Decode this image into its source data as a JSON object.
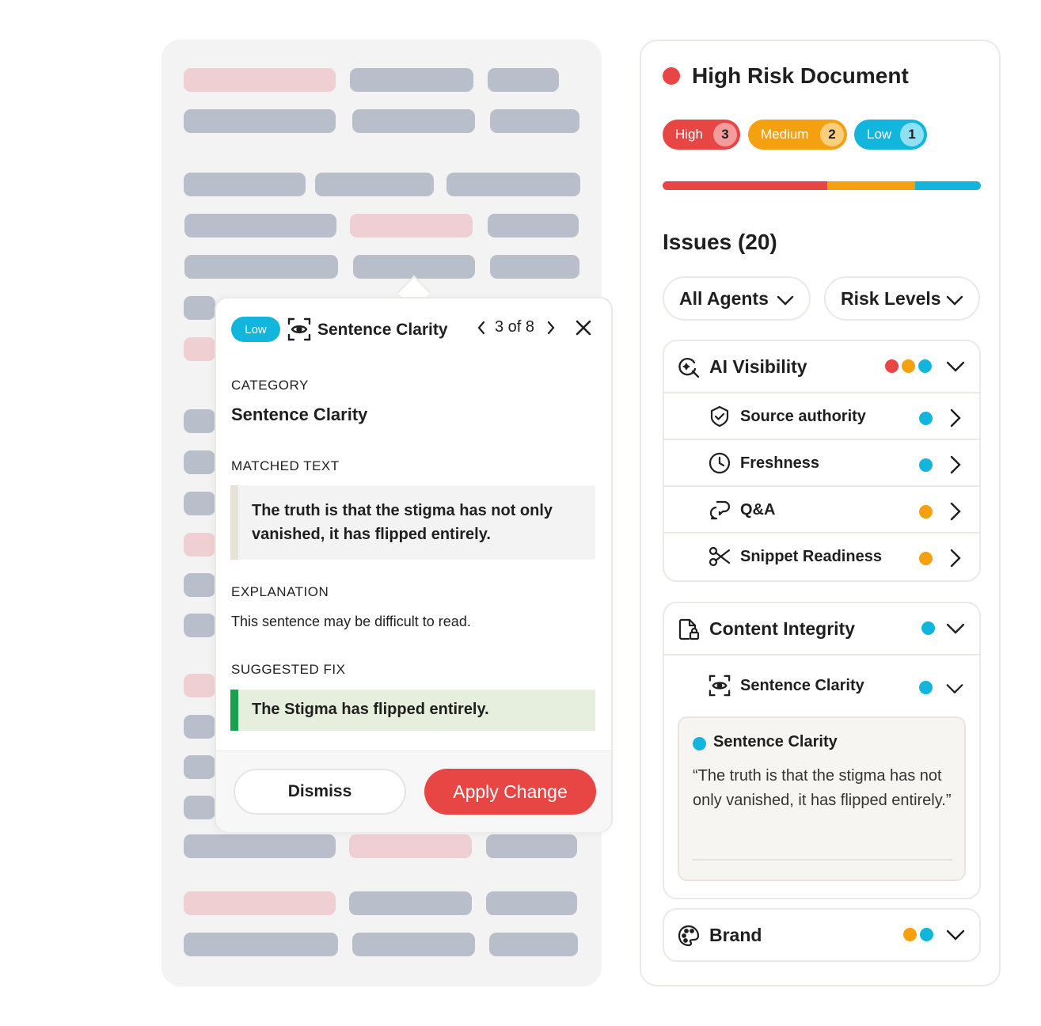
{
  "popup": {
    "risk_pill": "Low",
    "title": "Sentence Clarity",
    "pager": "3 of 8",
    "category_label": "CATEGORY",
    "category_value": "Sentence Clarity",
    "matched_label": "MATCHED TEXT",
    "matched_text": "The truth is that the stigma has not only vanished, it has flipped entirely.",
    "explanation_label": "EXPLANATION",
    "explanation_text": "This sentence may be difficult to read.",
    "fix_label": "SUGGESTED FIX",
    "fix_text": "The Stigma has flipped entirely.",
    "dismiss_label": "Dismiss",
    "apply_label": "Apply Change"
  },
  "risk": {
    "title": "High Risk Document",
    "levels": [
      {
        "label": "High",
        "count": "3",
        "color": "#e84545",
        "count_bg": "#f49b9b"
      },
      {
        "label": "Medium",
        "count": "2",
        "color": "#f5a00e",
        "count_bg": "#f9ce7c"
      },
      {
        "label": "Low",
        "count": "1",
        "color": "#12b6dc",
        "count_bg": "#8ee0f2"
      }
    ],
    "bar_segments": [
      {
        "value": 3,
        "color": "#e84545"
      },
      {
        "value": 1.6,
        "color": "#f5a00e"
      },
      {
        "value": 1.2,
        "color": "#12b6dc"
      }
    ]
  },
  "issues": {
    "title": "Issues (20)",
    "filters": [
      "All Agents",
      "Risk Levels"
    ]
  },
  "groups": {
    "ai_visibility": {
      "title": "AI Visibility",
      "icon": "search-sparkle-icon",
      "items": [
        {
          "label": "Source authority",
          "icon": "shield-check-icon",
          "status": "low"
        },
        {
          "label": "Freshness",
          "icon": "clock-icon",
          "status": "low"
        },
        {
          "label": "Q&A",
          "icon": "chat-bubbles-icon",
          "status": "medium"
        },
        {
          "label": "Snippet Readiness",
          "icon": "scissors-icon",
          "status": "medium"
        }
      ]
    },
    "content_integrity": {
      "title": "Content Integrity",
      "icon": "document-lock-icon",
      "sub_title": "Sentence Clarity",
      "detail_title": "Sentence Clarity",
      "detail_quote": "“The truth is that the stigma has not only vanished, it has flipped entirely.”"
    },
    "brand": {
      "title": "Brand",
      "icon": "palette-icon"
    }
  },
  "colors": {
    "high": "#e84545",
    "medium": "#f5a00e",
    "low": "#12b6dc"
  }
}
